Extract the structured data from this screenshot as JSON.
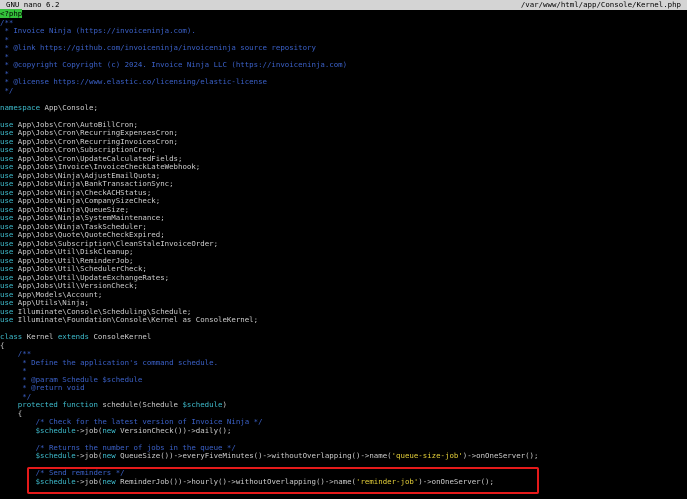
{
  "window": {
    "app_title": "GNU nano 6.2",
    "file_path": "/var/www/html/app/Console/Kernel.php"
  },
  "lines": [
    [
      {
        "t": "<?php",
        "c": "php"
      }
    ],
    [
      {
        "t": "/**",
        "c": "comment"
      }
    ],
    [
      {
        "t": " * Invoice Ninja (https://invoiceninja.com).",
        "c": "comment"
      }
    ],
    [
      {
        "t": " *",
        "c": "comment"
      }
    ],
    [
      {
        "t": " * @link https://github.com/invoiceninja/invoiceninja source repository",
        "c": "comment"
      }
    ],
    [
      {
        "t": " *",
        "c": "comment"
      }
    ],
    [
      {
        "t": " * @copyright Copyright (c) 2024. Invoice Ninja LLC (https://invoiceninja.com)",
        "c": "comment"
      }
    ],
    [
      {
        "t": " *",
        "c": "comment"
      }
    ],
    [
      {
        "t": " * @license https://www.elastic.co/licensing/elastic-license",
        "c": "comment"
      }
    ],
    [
      {
        "t": " */",
        "c": "comment"
      }
    ],
    [],
    [
      {
        "t": "namespace",
        "c": "kw"
      },
      {
        "t": " App\\Console;",
        "c": "plain"
      }
    ],
    [],
    [
      {
        "t": "use",
        "c": "kw"
      },
      {
        "t": " App\\Jobs\\Cron\\AutoBillCron;",
        "c": "plain"
      }
    ],
    [
      {
        "t": "use",
        "c": "kw"
      },
      {
        "t": " App\\Jobs\\Cron\\RecurringExpensesCron;",
        "c": "plain"
      }
    ],
    [
      {
        "t": "use",
        "c": "kw"
      },
      {
        "t": " App\\Jobs\\Cron\\RecurringInvoicesCron;",
        "c": "plain"
      }
    ],
    [
      {
        "t": "use",
        "c": "kw"
      },
      {
        "t": " App\\Jobs\\Cron\\SubscriptionCron;",
        "c": "plain"
      }
    ],
    [
      {
        "t": "use",
        "c": "kw"
      },
      {
        "t": " App\\Jobs\\Cron\\UpdateCalculatedFields;",
        "c": "plain"
      }
    ],
    [
      {
        "t": "use",
        "c": "kw"
      },
      {
        "t": " App\\Jobs\\Invoice\\InvoiceCheckLateWebhook;",
        "c": "plain"
      }
    ],
    [
      {
        "t": "use",
        "c": "kw"
      },
      {
        "t": " App\\Jobs\\Ninja\\AdjustEmailQuota;",
        "c": "plain"
      }
    ],
    [
      {
        "t": "use",
        "c": "kw"
      },
      {
        "t": " App\\Jobs\\Ninja\\BankTransactionSync;",
        "c": "plain"
      }
    ],
    [
      {
        "t": "use",
        "c": "kw"
      },
      {
        "t": " App\\Jobs\\Ninja\\CheckACHStatus;",
        "c": "plain"
      }
    ],
    [
      {
        "t": "use",
        "c": "kw"
      },
      {
        "t": " App\\Jobs\\Ninja\\CompanySizeCheck;",
        "c": "plain"
      }
    ],
    [
      {
        "t": "use",
        "c": "kw"
      },
      {
        "t": " App\\Jobs\\Ninja\\QueueSize;",
        "c": "plain"
      }
    ],
    [
      {
        "t": "use",
        "c": "kw"
      },
      {
        "t": " App\\Jobs\\Ninja\\SystemMaintenance;",
        "c": "plain"
      }
    ],
    [
      {
        "t": "use",
        "c": "kw"
      },
      {
        "t": " App\\Jobs\\Ninja\\TaskScheduler;",
        "c": "plain"
      }
    ],
    [
      {
        "t": "use",
        "c": "kw"
      },
      {
        "t": " App\\Jobs\\Quote\\QuoteCheckExpired;",
        "c": "plain"
      }
    ],
    [
      {
        "t": "use",
        "c": "kw"
      },
      {
        "t": " App\\Jobs\\Subscription\\CleanStaleInvoiceOrder;",
        "c": "plain"
      }
    ],
    [
      {
        "t": "use",
        "c": "kw"
      },
      {
        "t": " App\\Jobs\\Util\\DiskCleanup;",
        "c": "plain"
      }
    ],
    [
      {
        "t": "use",
        "c": "kw"
      },
      {
        "t": " App\\Jobs\\Util\\ReminderJob;",
        "c": "plain"
      }
    ],
    [
      {
        "t": "use",
        "c": "kw"
      },
      {
        "t": " App\\Jobs\\Util\\SchedulerCheck;",
        "c": "plain"
      }
    ],
    [
      {
        "t": "use",
        "c": "kw"
      },
      {
        "t": " App\\Jobs\\Util\\UpdateExchangeRates;",
        "c": "plain"
      }
    ],
    [
      {
        "t": "use",
        "c": "kw"
      },
      {
        "t": " App\\Jobs\\Util\\VersionCheck;",
        "c": "plain"
      }
    ],
    [
      {
        "t": "use",
        "c": "kw"
      },
      {
        "t": " App\\Models\\Account;",
        "c": "plain"
      }
    ],
    [
      {
        "t": "use",
        "c": "kw"
      },
      {
        "t": " App\\Utils\\Ninja;",
        "c": "plain"
      }
    ],
    [
      {
        "t": "use",
        "c": "kw"
      },
      {
        "t": " Illuminate\\Console\\Scheduling\\Schedule;",
        "c": "plain"
      }
    ],
    [
      {
        "t": "use",
        "c": "kw"
      },
      {
        "t": " Illuminate\\Foundation\\Console\\Kernel as ConsoleKernel;",
        "c": "plain"
      }
    ],
    [],
    [
      {
        "t": "class",
        "c": "kw"
      },
      {
        "t": " Kernel ",
        "c": "plain"
      },
      {
        "t": "extends",
        "c": "kw"
      },
      {
        "t": " ConsoleKernel",
        "c": "plain"
      }
    ],
    [
      {
        "t": "{",
        "c": "plain"
      }
    ],
    [
      {
        "t": "    /**",
        "c": "comment"
      }
    ],
    [
      {
        "t": "     * Define the application's command schedule.",
        "c": "comment"
      }
    ],
    [
      {
        "t": "     *",
        "c": "comment"
      }
    ],
    [
      {
        "t": "     * @param Schedule $schedule",
        "c": "comment"
      }
    ],
    [
      {
        "t": "     * @return void",
        "c": "comment"
      }
    ],
    [
      {
        "t": "     */",
        "c": "comment"
      }
    ],
    [
      {
        "t": "    protected function",
        "c": "kw"
      },
      {
        "t": " schedule(Schedule ",
        "c": "plain"
      },
      {
        "t": "$schedule",
        "c": "var"
      },
      {
        "t": ")",
        "c": "plain"
      }
    ],
    [
      {
        "t": "    {",
        "c": "plain"
      }
    ],
    [
      {
        "t": "        /* Check for the latest version of Invoice Ninja */",
        "c": "comment"
      }
    ],
    [
      {
        "t": "        $schedule",
        "c": "var"
      },
      {
        "t": "->job(",
        "c": "plain"
      },
      {
        "t": "new",
        "c": "kw"
      },
      {
        "t": " VersionCheck())->daily();",
        "c": "plain"
      }
    ],
    [],
    [
      {
        "t": "        /* Returns the number of jobs in the queue */",
        "c": "comment"
      }
    ],
    [
      {
        "t": "        $schedule",
        "c": "var"
      },
      {
        "t": "->job(",
        "c": "plain"
      },
      {
        "t": "new",
        "c": "kw"
      },
      {
        "t": " QueueSize())->everyFiveMinutes()->withoutOverlapping()->name(",
        "c": "plain"
      },
      {
        "t": "'queue-size-job'",
        "c": "str"
      },
      {
        "t": ")->onOneServer();",
        "c": "plain"
      }
    ],
    [],
    [
      {
        "t": "        /* Send reminders */",
        "c": "comment"
      }
    ],
    [
      {
        "t": "        $schedule",
        "c": "var"
      },
      {
        "t": "->job(",
        "c": "plain"
      },
      {
        "t": "new",
        "c": "kw"
      },
      {
        "t": " ReminderJob())->hourly()->withoutOverlapping()->name(",
        "c": "plain"
      },
      {
        "t": "'reminder-job'",
        "c": "str"
      },
      {
        "t": ")->onOneServer();",
        "c": "plain"
      }
    ]
  ]
}
